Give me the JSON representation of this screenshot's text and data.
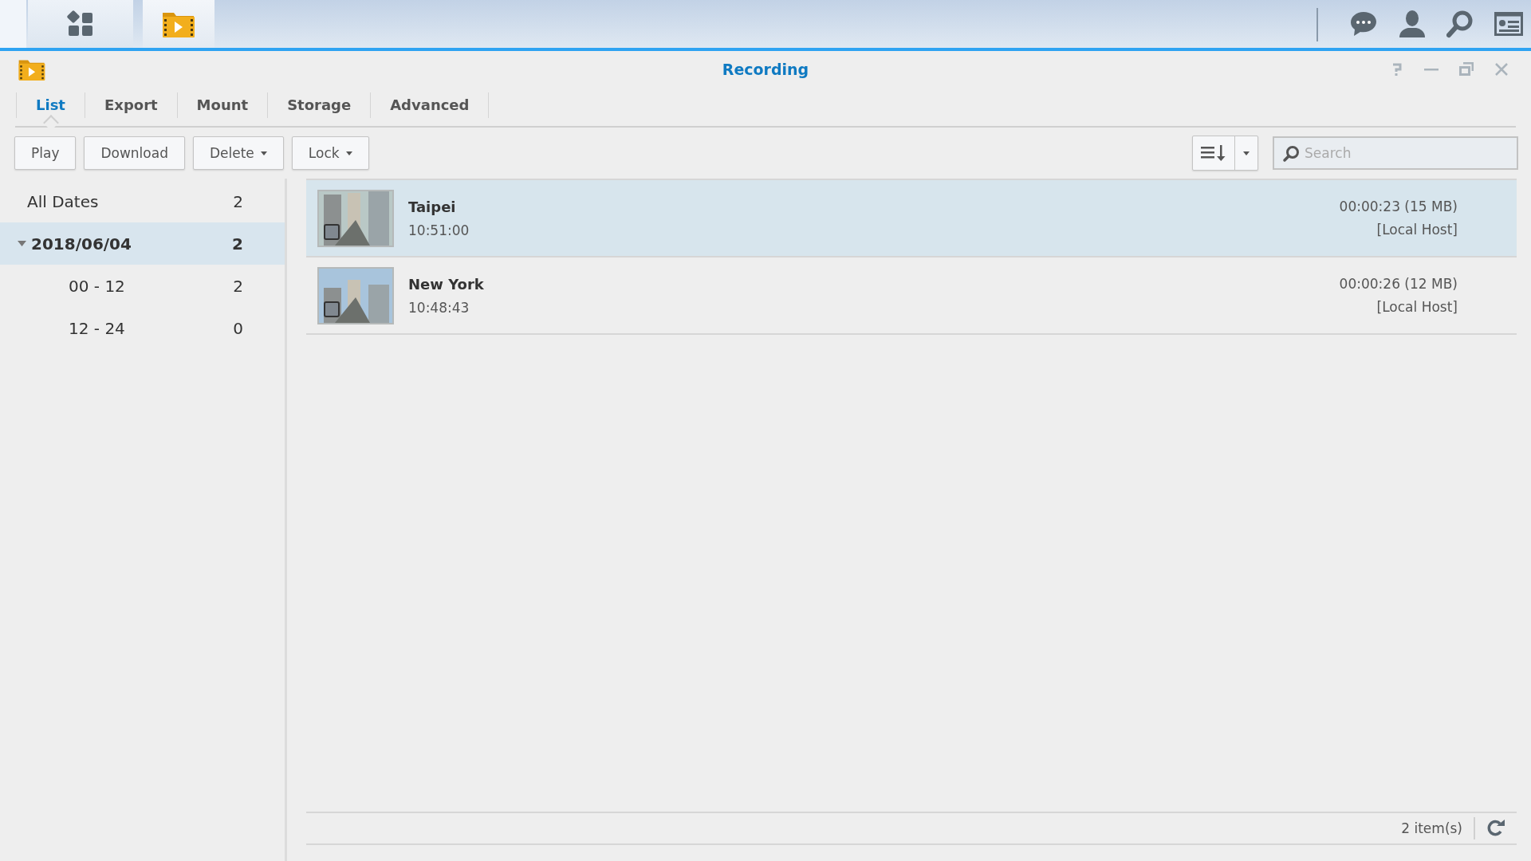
{
  "window": {
    "title": "Recording"
  },
  "tabs": [
    {
      "label": "List",
      "selected": true
    },
    {
      "label": "Export",
      "selected": false
    },
    {
      "label": "Mount",
      "selected": false
    },
    {
      "label": "Storage",
      "selected": false
    },
    {
      "label": "Advanced",
      "selected": false
    }
  ],
  "toolbar": {
    "buttons": [
      {
        "label": "Play",
        "dropdown": false
      },
      {
        "label": "Download",
        "dropdown": false
      },
      {
        "label": "Delete",
        "dropdown": true
      },
      {
        "label": "Lock",
        "dropdown": true
      }
    ],
    "search": {
      "placeholder": "Search"
    }
  },
  "sidebar": {
    "items": [
      {
        "label": "All Dates",
        "count": "2",
        "selected": false
      },
      {
        "label": "2018/06/04",
        "count": "2",
        "selected": true,
        "expanded": true,
        "children": [
          {
            "label": "00 - 12",
            "count": "2",
            "selected": false
          },
          {
            "label": "12 - 24",
            "count": "0",
            "selected": false
          }
        ]
      }
    ]
  },
  "recordings": [
    {
      "camera": "Taipei",
      "time": "10:51:00",
      "duration": "00:00:23 (15 MB)",
      "host": "[Local Host]",
      "selected": true
    },
    {
      "camera": "New York",
      "time": "10:48:43",
      "duration": "00:00:26 (12 MB)",
      "host": "[Local Host]",
      "selected": false
    }
  ],
  "status_bar": {
    "count": "2 item(s)"
  }
}
